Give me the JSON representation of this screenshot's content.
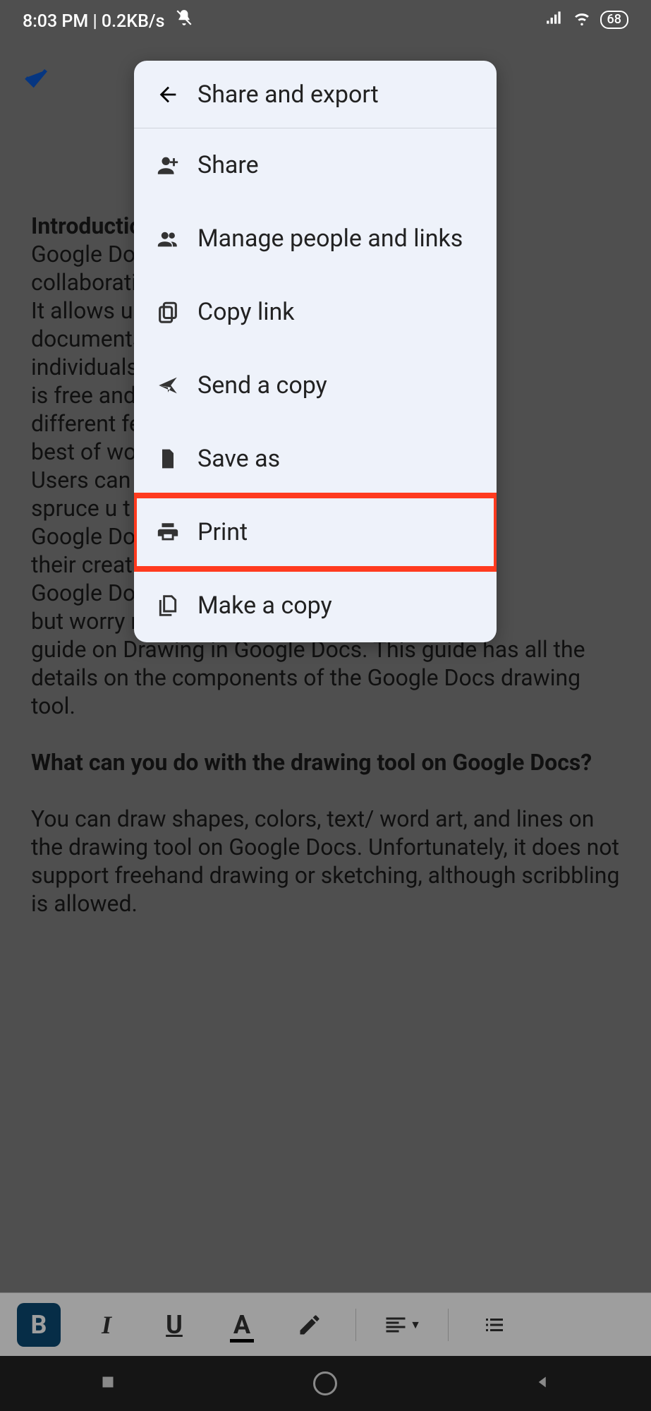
{
  "status": {
    "time": "8:03 PM",
    "speed": "0.2KB/s",
    "battery": "68"
  },
  "menu": {
    "title": "Share and export",
    "items": [
      {
        "label": "Share",
        "icon": "person-add-icon"
      },
      {
        "label": "Manage people and links",
        "icon": "people-icon"
      },
      {
        "label": "Copy link",
        "icon": "copy-icon"
      },
      {
        "label": "Send a copy",
        "icon": "send-icon"
      },
      {
        "label": "Save as",
        "icon": "file-icon"
      },
      {
        "label": "Print",
        "icon": "print-icon",
        "highlighted": true
      },
      {
        "label": "Make a copy",
        "icon": "duplicate-icon"
      }
    ]
  },
  "document": {
    "heading1": "Introductio",
    "para1_lines": "Google Do\ncollaboratio\nIt allows us\ndocuments\nindividuals\nis free and\ndifferent fea\nbest of wor\nUsers can\nspruce u  t\nGoogle Do\ntheir creati\nGoogle Do\nbut worry n\nguide on Drawing in Google Docs. This guide has all the details on the components of the Google Docs drawing tool.",
    "heading2": "What can you do with the drawing tool on Google Docs?",
    "para2": "You can draw shapes, colors, text/ word art, and lines on the drawing tool on Google Docs. Unfortunately, it does not support freehand drawing or sketching, although scribbling is allowed."
  },
  "toolbar": {
    "bold": "B",
    "italic": "I",
    "underline": "U",
    "textcolor": "A"
  }
}
